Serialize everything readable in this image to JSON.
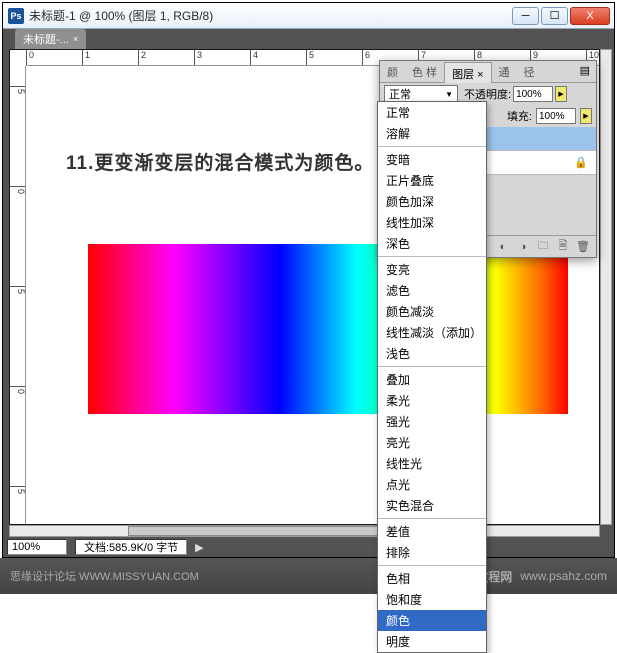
{
  "window": {
    "app_icon": "Ps",
    "title": "未标题-1 @ 100% (图层 1, RGB/8)"
  },
  "doc_tab": {
    "label": "未标题-...",
    "close": "×"
  },
  "ruler_h": [
    "0",
    "1",
    "2",
    "3",
    "4",
    "5",
    "6",
    "7",
    "8",
    "9",
    "10"
  ],
  "ruler_v": [
    "5",
    "0",
    "5",
    "0",
    "5"
  ],
  "instruction": "11.更变渐变层的混合模式为颜色。",
  "status": {
    "zoom": "100%",
    "doc": "文档:585.9K/0 字节"
  },
  "layers_panel": {
    "tabs": [
      "颜",
      "色 样",
      "图层 ×",
      "通",
      "径"
    ],
    "opacity_label": "不透明度:",
    "opacity_value": "100%",
    "fill_label": "填充:",
    "fill_value": "100%",
    "blend_current": "正常",
    "layer1": "",
    "bg_label": ""
  },
  "blend_modes": {
    "g1": [
      "正常",
      "溶解"
    ],
    "g2": [
      "变暗",
      "正片叠底",
      "颜色加深",
      "线性加深",
      "深色"
    ],
    "g3": [
      "变亮",
      "滤色",
      "颜色减淡",
      "线性减淡（添加）",
      "浅色"
    ],
    "g4": [
      "叠加",
      "柔光",
      "强光",
      "亮光",
      "线性光",
      "点光",
      "实色混合"
    ],
    "g5": [
      "差值",
      "排除"
    ],
    "g6": [
      "色相",
      "饱和度",
      "颜色",
      "明度"
    ]
  },
  "footer": {
    "left": "思缘设计论坛  WWW.MISSYUAN.COM",
    "right_brand": "PS爱好者教程网",
    "right_url": "www.psahz.com"
  }
}
